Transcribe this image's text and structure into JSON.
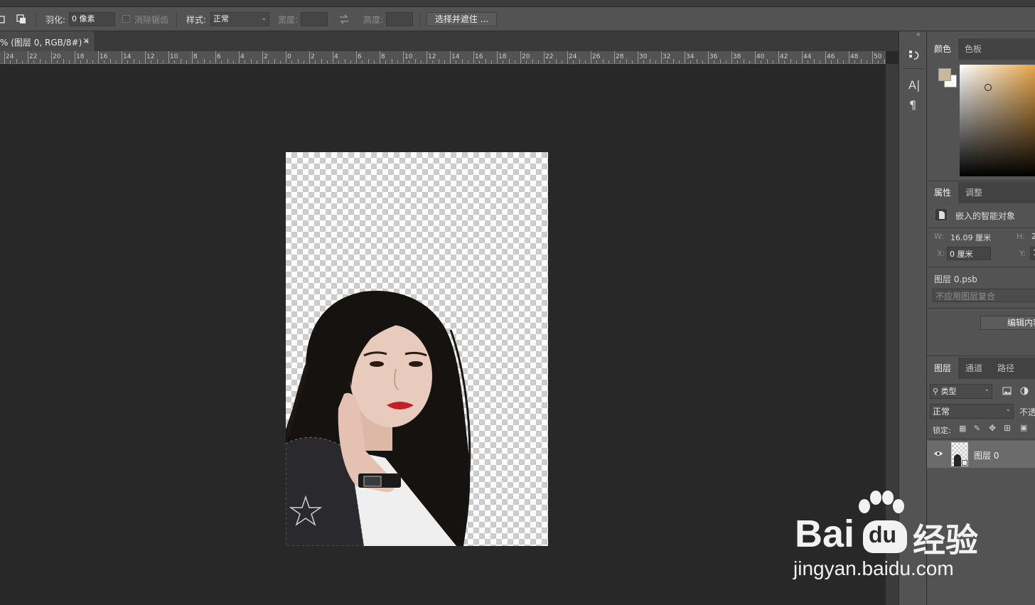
{
  "options_bar": {
    "feather_label": "羽化:",
    "feather_value": "0 像素",
    "antialias_label": "消除锯齿",
    "style_label": "样式:",
    "style_value": "正常",
    "width_label": "宽度:",
    "height_label": "高度:",
    "select_mask_button": "选择并遮住 ..."
  },
  "document_tab": {
    "title": "% (图层 0, RGB/8#) *",
    "close": "×"
  },
  "ruler": {
    "labels": [
      "24",
      "22",
      "20",
      "18",
      "16",
      "14",
      "12",
      "10",
      "8",
      "6",
      "4",
      "2",
      "0",
      "2",
      "4",
      "6",
      "8",
      "10",
      "12",
      "14",
      "16",
      "18",
      "20",
      "22",
      "24",
      "26",
      "28",
      "30",
      "32",
      "34",
      "36",
      "38",
      "40",
      "42",
      "44",
      "46",
      "48",
      "50"
    ]
  },
  "color_panel": {
    "tab_color": "颜色",
    "tab_swatches": "色板",
    "foreground": "#c9b99a",
    "background": "#ffffff"
  },
  "properties_panel": {
    "tab_properties": "属性",
    "tab_adjustments": "调整",
    "object_type": "嵌入的智能对象",
    "w_label": "W:",
    "w_value": "16.09 厘米",
    "h_label": "H:",
    "h_value_partial": "2",
    "x_label": "X:",
    "x_value": "0 厘米",
    "y_label": "Y:",
    "y_value_partial": "1",
    "file_name": "图层 0.psb",
    "comp_select": "不应用图层复合",
    "edit_contents_partial": "编辑内容"
  },
  "layers_panel": {
    "tab_layers": "图层",
    "tab_channels": "通道",
    "tab_paths": "路径",
    "filter_kind": "类型",
    "blend_mode": "正常",
    "opacity_partial": "不透",
    "lock_label": "锁定:",
    "layer_name": "图层 0"
  },
  "watermark": {
    "brand_bai": "Bai",
    "brand_du": "du",
    "brand_cn": "经验",
    "url": "jingyan.baidu.com"
  }
}
